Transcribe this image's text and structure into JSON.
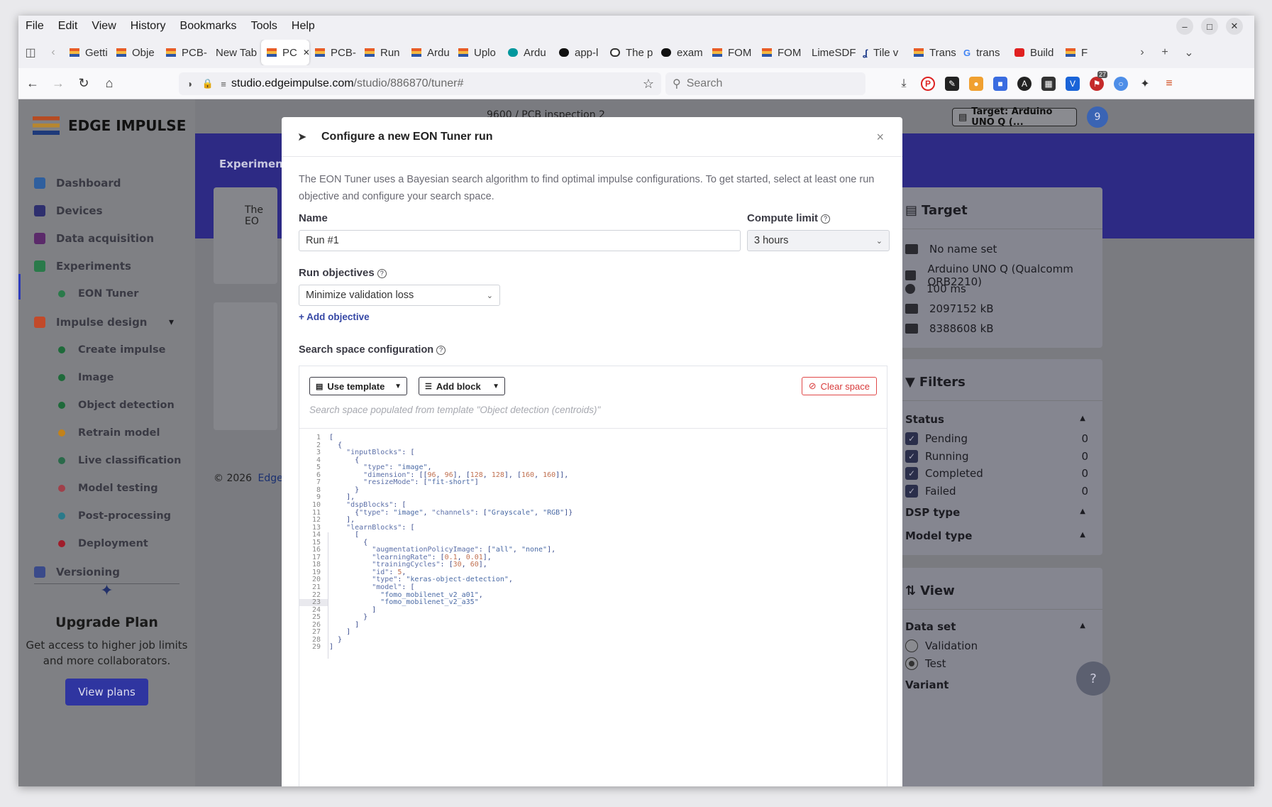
{
  "menubar": {
    "items": [
      "File",
      "Edit",
      "View",
      "History",
      "Bookmarks",
      "Tools",
      "Help"
    ]
  },
  "tabs": [
    {
      "label": "Getti",
      "fav": "ei"
    },
    {
      "label": "Obje",
      "fav": "ei"
    },
    {
      "label": "PCB-",
      "fav": "ei"
    },
    {
      "label": "New Tab",
      "fav": ""
    },
    {
      "label": "PC",
      "fav": "ei",
      "active": true
    },
    {
      "label": "PCB-",
      "fav": "ei"
    },
    {
      "label": "Run",
      "fav": "ei"
    },
    {
      "label": "Ardu",
      "fav": "ei"
    },
    {
      "label": "Uplo",
      "fav": "ei"
    },
    {
      "label": "Ardu",
      "fav": "ard"
    },
    {
      "label": "app-l",
      "fav": "gh"
    },
    {
      "label": "The p",
      "fav": "w"
    },
    {
      "label": "exam",
      "fav": "gh"
    },
    {
      "label": "FOM",
      "fav": "ei"
    },
    {
      "label": "FOM",
      "fav": "ei"
    },
    {
      "label": "LimeSDF",
      "fav": ""
    },
    {
      "label": "Tile v",
      "fav": "tile"
    },
    {
      "label": "Trans",
      "fav": "ei"
    },
    {
      "label": "trans",
      "fav": "g"
    },
    {
      "label": "Build",
      "fav": "yt"
    },
    {
      "label": "F",
      "fav": "ei"
    }
  ],
  "url": {
    "host": "studio.edgeimpulse.com",
    "path": "/studio/886870/tuner#"
  },
  "search": {
    "placeholder": "Search"
  },
  "ext_badge": "27",
  "app": {
    "brand": "EDGE IMPULSE",
    "project_info": "9600 / PCB inspection 2",
    "target_button": "Target: Arduino UNO Q (...",
    "avatar": "9",
    "hero_title": "Experiment",
    "card_text": "The EO",
    "footer": "© 2026",
    "footer_link": "EdgeI"
  },
  "sidebar": {
    "items": [
      {
        "label": "Dashboard",
        "icon": "monitor-icon"
      },
      {
        "label": "Devices",
        "icon": "chip-icon"
      },
      {
        "label": "Data acquisition",
        "icon": "database-icon"
      },
      {
        "label": "Experiments",
        "icon": "grid-icon"
      },
      {
        "label": "EON Tuner",
        "icon": "compass-icon"
      },
      {
        "label": "Impulse design",
        "icon": "pulse-icon"
      },
      {
        "label": "Create impulse",
        "icon": "dot-icon"
      },
      {
        "label": "Image",
        "icon": "dot-icon"
      },
      {
        "label": "Object detection",
        "icon": "dot-icon"
      },
      {
        "label": "Retrain model",
        "icon": "shuffle-icon"
      },
      {
        "label": "Live classification",
        "icon": "wave-icon"
      },
      {
        "label": "Model testing",
        "icon": "flask-icon"
      },
      {
        "label": "Post-processing",
        "icon": "doc-icon"
      },
      {
        "label": "Deployment",
        "icon": "cube-icon"
      },
      {
        "label": "Versioning",
        "icon": "branch-icon"
      }
    ],
    "upgrade": {
      "title": "Upgrade Plan",
      "text1": "Get access to higher job limits",
      "text2": "and more collaborators.",
      "button": "View plans"
    }
  },
  "right_panel": {
    "target": {
      "title": "Target",
      "rows": [
        "No name set",
        "Arduino UNO Q (Qualcomm QRB2210)",
        "100 ms",
        "2097152 kB",
        "8388608 kB"
      ]
    },
    "filters": {
      "title": "Filters",
      "status_label": "Status",
      "statuses": [
        {
          "label": "Pending",
          "count": "0"
        },
        {
          "label": "Running",
          "count": "0"
        },
        {
          "label": "Completed",
          "count": "0"
        },
        {
          "label": "Failed",
          "count": "0"
        }
      ],
      "dsp": "DSP type",
      "model": "Model type"
    },
    "view": {
      "title": "View",
      "dataset_label": "Data set",
      "options": [
        "Validation",
        "Test"
      ],
      "selected": "Test",
      "variant": "Variant"
    }
  },
  "modal": {
    "title": "Configure a new EON Tuner run",
    "intro": "The EON Tuner uses a Bayesian search algorithm to find optimal impulse configurations. To get started, select at least one run objective and configure your search space.",
    "name_label": "Name",
    "name_value": "Run #1",
    "compute_label": "Compute limit",
    "compute_value": "3 hours",
    "objectives_label": "Run objectives",
    "objective_value": "Minimize validation loss",
    "add_objective": "+ Add objective",
    "search_label": "Search space configuration",
    "use_template": "Use template",
    "add_block": "Add block",
    "clear_space": "Clear space",
    "hint": "Search space populated from template \"Object detection (centroids)\"",
    "code_lines": [
      "[",
      "  {",
      "    \"inputBlocks\": [",
      "      {",
      "        \"type\": \"image\",",
      "        \"dimension\": [[96, 96], [128, 128], [160, 160]],",
      "        \"resizeMode\": [\"fit-short\"]",
      "      }",
      "    ],",
      "    \"dspBlocks\": [",
      "      {\"type\": \"image\", \"channels\": [\"Grayscale\", \"RGB\"]}",
      "    ],",
      "    \"learnBlocks\": [",
      "      [",
      "        {",
      "          \"augmentationPolicyImage\": [\"all\", \"none\"],",
      "          \"learningRate\": [0.1, 0.01],",
      "          \"trainingCycles\": [30, 60],",
      "          \"id\": 5,",
      "          \"type\": \"keras-object-detection\",",
      "          \"model\": [",
      "            \"fomo_mobilenet_v2_a01\",",
      "            \"fomo_mobilenet_v2_a35\"",
      "          ]",
      "        }",
      "      ]",
      "    ]",
      "  }",
      "]"
    ]
  }
}
